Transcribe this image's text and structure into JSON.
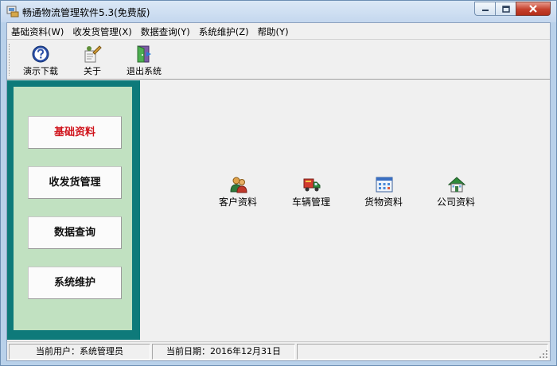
{
  "window": {
    "title": "畅通物流管理软件5.3(免费版)"
  },
  "menubar": {
    "items": [
      {
        "label": "基础资料(W)"
      },
      {
        "label": "收发货管理(X)"
      },
      {
        "label": "数据查询(Y)"
      },
      {
        "label": "系统维护(Z)"
      },
      {
        "label": "帮助(Y)"
      }
    ]
  },
  "toolbar": {
    "buttons": [
      {
        "label": "演示下载",
        "icon": "help-icon"
      },
      {
        "label": "关于",
        "icon": "about-icon"
      },
      {
        "label": "退出系统",
        "icon": "exit-door-icon"
      }
    ]
  },
  "nav": {
    "buttons": [
      {
        "label": "基础资料",
        "active": true
      },
      {
        "label": "收发货管理",
        "active": false
      },
      {
        "label": "数据查询",
        "active": false
      },
      {
        "label": "系统维护",
        "active": false
      }
    ],
    "active_color": "#d0141c",
    "panel_color": "#0e7a7a",
    "panel_inner_color": "#c1e1c1"
  },
  "main": {
    "features": [
      {
        "label": "客户资料",
        "icon": "customers-icon"
      },
      {
        "label": "车辆管理",
        "icon": "vehicle-icon"
      },
      {
        "label": "货物资料",
        "icon": "goods-icon"
      },
      {
        "label": "公司资料",
        "icon": "company-icon"
      }
    ]
  },
  "statusbar": {
    "user": "当前用户：系统管理员",
    "date": "当前日期：2016年12月31日"
  }
}
